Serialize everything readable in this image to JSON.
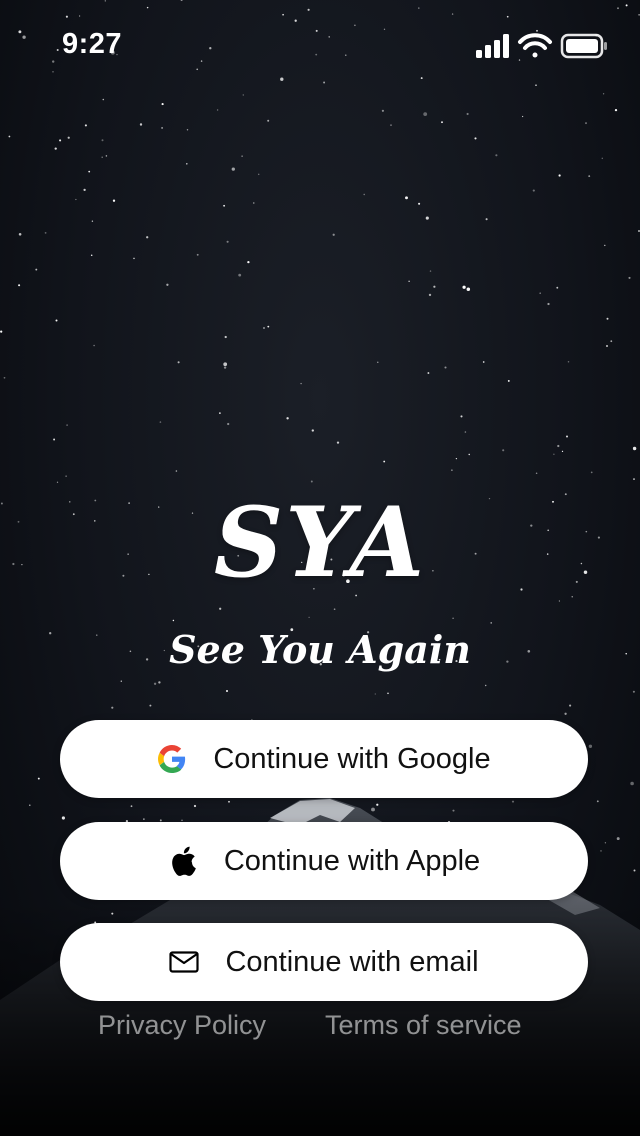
{
  "status_bar": {
    "time": "9:27",
    "icons": [
      "cellular-signal-icon",
      "wifi-icon",
      "battery-icon"
    ]
  },
  "app": {
    "logo": "SYA",
    "tagline": "See You Again"
  },
  "auth_buttons": [
    {
      "label": "Continue with Google",
      "icon": "google-icon"
    },
    {
      "label": "Continue with Apple",
      "icon": "apple-icon"
    },
    {
      "label": "Continue with email",
      "icon": "mail-icon"
    }
  ],
  "footer": {
    "privacy_label": "Privacy Policy",
    "terms_label": "Terms of service"
  },
  "colors": {
    "background": "#0b0e15",
    "button_bg": "#ffffff",
    "button_text": "#111111",
    "footer_text": "#8c8f95",
    "google_blue": "#4285F4",
    "google_red": "#EA4335",
    "google_yellow": "#FBBC05",
    "google_green": "#34A853"
  }
}
